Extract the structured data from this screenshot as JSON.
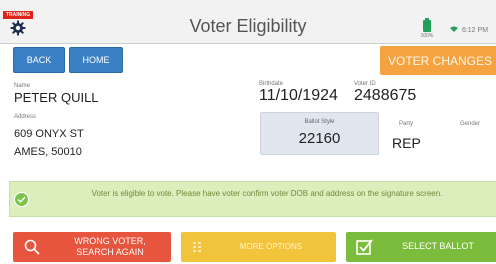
{
  "header": {
    "training_badge": "TRAINING",
    "title": "Voter Eligibility",
    "battery": "100%",
    "time": "6:12 PM"
  },
  "nav": {
    "back": "BACK",
    "home": "HOME",
    "voter_changes": "VOTER CHANGES"
  },
  "voter": {
    "name_label": "Name",
    "name": "PETER QUILL",
    "address_label": "Address",
    "address_line1": "609 ONYX ST",
    "address_line2": "AMES, 50010",
    "birthdate_label": "Birthdate",
    "birthdate": "11/10/1924",
    "voter_id_label": "Voter ID",
    "voter_id": "2488675",
    "ballot_style_label": "Ballot Style",
    "ballot_style": "22160",
    "party_label": "Party",
    "party": "REP",
    "gender_label": "Gender"
  },
  "eligibility": {
    "message": "Voter is eligible to vote. Please have voter confirm voter DOB and address on the signature screen."
  },
  "actions": {
    "wrong_voter_line1": "WRONG VOTER,",
    "wrong_voter_line2": "SEARCH AGAIN",
    "more_options": "MORE OPTIONS",
    "select_ballot": "SELECT BALLOT"
  },
  "colors": {
    "primary_blue": "#3b7fc4",
    "orange": "#f5a240",
    "red": "#e7553e",
    "yellow": "#f2c43c",
    "green": "#7cbc3c",
    "banner_bg": "#ddeebd"
  },
  "icons": [
    "gear-icon",
    "battery-icon",
    "wifi-icon",
    "check-circle-icon",
    "search-icon",
    "list-icon",
    "checkbox-icon"
  ]
}
